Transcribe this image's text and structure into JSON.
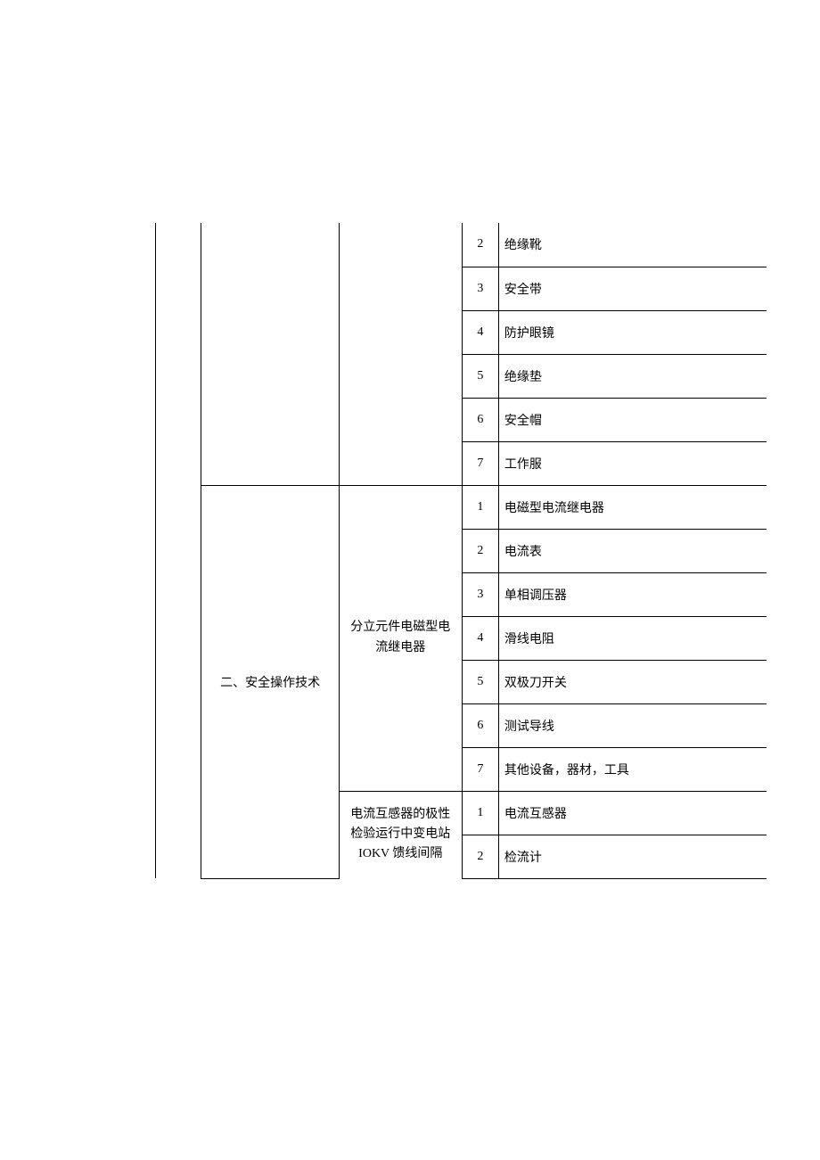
{
  "section1": {
    "items": [
      {
        "num": "2",
        "name": "绝缘靴"
      },
      {
        "num": "3",
        "name": "安全带"
      },
      {
        "num": "4",
        "name": "防护眼镜"
      },
      {
        "num": "5",
        "name": "绝缘垫"
      },
      {
        "num": "6",
        "name": "安全帽"
      },
      {
        "num": "7",
        "name": "工作服"
      }
    ]
  },
  "section2": {
    "title": "二、安全操作技术",
    "group1": {
      "title": "分立元件电磁型电流继电器",
      "items": [
        {
          "num": "1",
          "name": "电磁型电流继电器"
        },
        {
          "num": "2",
          "name": "电流表"
        },
        {
          "num": "3",
          "name": "单相调压器"
        },
        {
          "num": "4",
          "name": "滑线电阻"
        },
        {
          "num": "5",
          "name": "双极刀开关"
        },
        {
          "num": "6",
          "name": "测试导线"
        },
        {
          "num": "7",
          "name": "其他设备，器材，工具"
        }
      ]
    },
    "group2": {
      "title": "电流互感器的极性检验运行中变电站 IOKV 馈线间隔",
      "items": [
        {
          "num": "1",
          "name": "电流互感器"
        },
        {
          "num": "2",
          "name": "检流计"
        }
      ]
    }
  }
}
